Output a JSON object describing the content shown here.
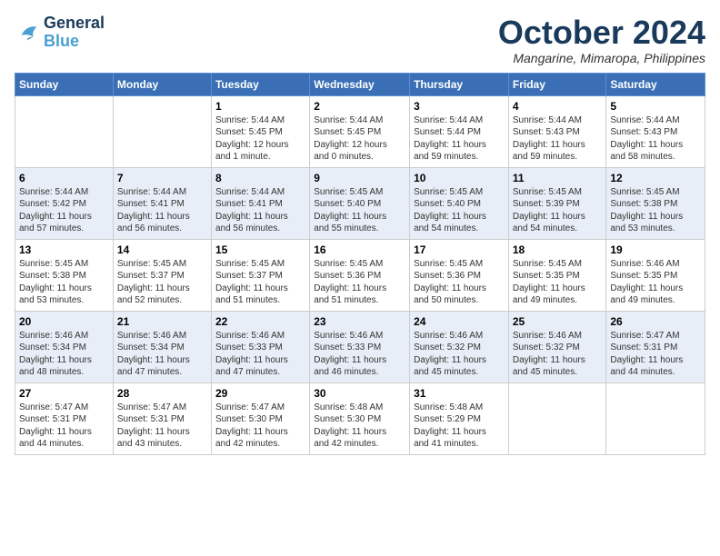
{
  "header": {
    "logo_line1": "General",
    "logo_line2": "Blue",
    "month": "October 2024",
    "location": "Mangarine, Mimaropa, Philippines"
  },
  "days_of_week": [
    "Sunday",
    "Monday",
    "Tuesday",
    "Wednesday",
    "Thursday",
    "Friday",
    "Saturday"
  ],
  "weeks": [
    [
      {
        "day": "",
        "info": ""
      },
      {
        "day": "",
        "info": ""
      },
      {
        "day": "1",
        "info": "Sunrise: 5:44 AM\nSunset: 5:45 PM\nDaylight: 12 hours\nand 1 minute."
      },
      {
        "day": "2",
        "info": "Sunrise: 5:44 AM\nSunset: 5:45 PM\nDaylight: 12 hours\nand 0 minutes."
      },
      {
        "day": "3",
        "info": "Sunrise: 5:44 AM\nSunset: 5:44 PM\nDaylight: 11 hours\nand 59 minutes."
      },
      {
        "day": "4",
        "info": "Sunrise: 5:44 AM\nSunset: 5:43 PM\nDaylight: 11 hours\nand 59 minutes."
      },
      {
        "day": "5",
        "info": "Sunrise: 5:44 AM\nSunset: 5:43 PM\nDaylight: 11 hours\nand 58 minutes."
      }
    ],
    [
      {
        "day": "6",
        "info": "Sunrise: 5:44 AM\nSunset: 5:42 PM\nDaylight: 11 hours\nand 57 minutes."
      },
      {
        "day": "7",
        "info": "Sunrise: 5:44 AM\nSunset: 5:41 PM\nDaylight: 11 hours\nand 56 minutes."
      },
      {
        "day": "8",
        "info": "Sunrise: 5:44 AM\nSunset: 5:41 PM\nDaylight: 11 hours\nand 56 minutes."
      },
      {
        "day": "9",
        "info": "Sunrise: 5:45 AM\nSunset: 5:40 PM\nDaylight: 11 hours\nand 55 minutes."
      },
      {
        "day": "10",
        "info": "Sunrise: 5:45 AM\nSunset: 5:40 PM\nDaylight: 11 hours\nand 54 minutes."
      },
      {
        "day": "11",
        "info": "Sunrise: 5:45 AM\nSunset: 5:39 PM\nDaylight: 11 hours\nand 54 minutes."
      },
      {
        "day": "12",
        "info": "Sunrise: 5:45 AM\nSunset: 5:38 PM\nDaylight: 11 hours\nand 53 minutes."
      }
    ],
    [
      {
        "day": "13",
        "info": "Sunrise: 5:45 AM\nSunset: 5:38 PM\nDaylight: 11 hours\nand 53 minutes."
      },
      {
        "day": "14",
        "info": "Sunrise: 5:45 AM\nSunset: 5:37 PM\nDaylight: 11 hours\nand 52 minutes."
      },
      {
        "day": "15",
        "info": "Sunrise: 5:45 AM\nSunset: 5:37 PM\nDaylight: 11 hours\nand 51 minutes."
      },
      {
        "day": "16",
        "info": "Sunrise: 5:45 AM\nSunset: 5:36 PM\nDaylight: 11 hours\nand 51 minutes."
      },
      {
        "day": "17",
        "info": "Sunrise: 5:45 AM\nSunset: 5:36 PM\nDaylight: 11 hours\nand 50 minutes."
      },
      {
        "day": "18",
        "info": "Sunrise: 5:45 AM\nSunset: 5:35 PM\nDaylight: 11 hours\nand 49 minutes."
      },
      {
        "day": "19",
        "info": "Sunrise: 5:46 AM\nSunset: 5:35 PM\nDaylight: 11 hours\nand 49 minutes."
      }
    ],
    [
      {
        "day": "20",
        "info": "Sunrise: 5:46 AM\nSunset: 5:34 PM\nDaylight: 11 hours\nand 48 minutes."
      },
      {
        "day": "21",
        "info": "Sunrise: 5:46 AM\nSunset: 5:34 PM\nDaylight: 11 hours\nand 47 minutes."
      },
      {
        "day": "22",
        "info": "Sunrise: 5:46 AM\nSunset: 5:33 PM\nDaylight: 11 hours\nand 47 minutes."
      },
      {
        "day": "23",
        "info": "Sunrise: 5:46 AM\nSunset: 5:33 PM\nDaylight: 11 hours\nand 46 minutes."
      },
      {
        "day": "24",
        "info": "Sunrise: 5:46 AM\nSunset: 5:32 PM\nDaylight: 11 hours\nand 45 minutes."
      },
      {
        "day": "25",
        "info": "Sunrise: 5:46 AM\nSunset: 5:32 PM\nDaylight: 11 hours\nand 45 minutes."
      },
      {
        "day": "26",
        "info": "Sunrise: 5:47 AM\nSunset: 5:31 PM\nDaylight: 11 hours\nand 44 minutes."
      }
    ],
    [
      {
        "day": "27",
        "info": "Sunrise: 5:47 AM\nSunset: 5:31 PM\nDaylight: 11 hours\nand 44 minutes."
      },
      {
        "day": "28",
        "info": "Sunrise: 5:47 AM\nSunset: 5:31 PM\nDaylight: 11 hours\nand 43 minutes."
      },
      {
        "day": "29",
        "info": "Sunrise: 5:47 AM\nSunset: 5:30 PM\nDaylight: 11 hours\nand 42 minutes."
      },
      {
        "day": "30",
        "info": "Sunrise: 5:48 AM\nSunset: 5:30 PM\nDaylight: 11 hours\nand 42 minutes."
      },
      {
        "day": "31",
        "info": "Sunrise: 5:48 AM\nSunset: 5:29 PM\nDaylight: 11 hours\nand 41 minutes."
      },
      {
        "day": "",
        "info": ""
      },
      {
        "day": "",
        "info": ""
      }
    ]
  ]
}
